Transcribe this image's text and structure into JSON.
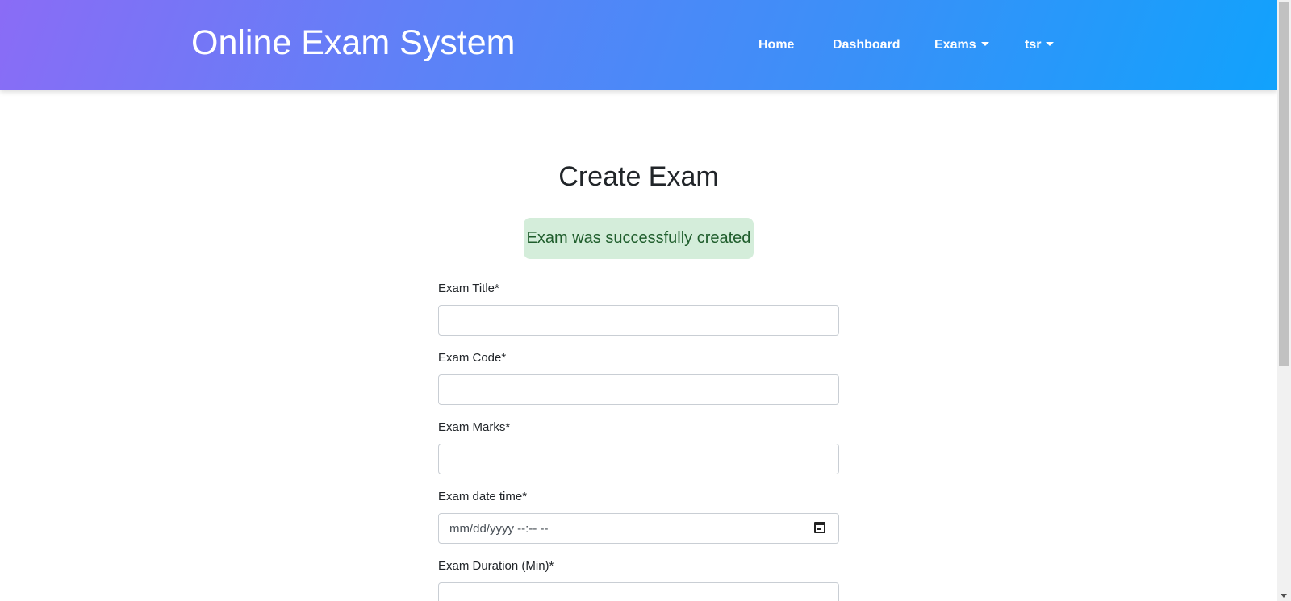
{
  "navbar": {
    "brand": "Online Exam System",
    "links": {
      "home": "Home",
      "dashboard": "Dashboard",
      "exams": "Exams",
      "user": "tsr"
    }
  },
  "main": {
    "title": "Create Exam",
    "alert": "Exam was successfully created"
  },
  "form": {
    "title_label": "Exam Title*",
    "title_value": "",
    "code_label": "Exam Code*",
    "code_value": "",
    "marks_label": "Exam Marks*",
    "marks_value": "",
    "datetime_label": "Exam date time*",
    "datetime_placeholder": "mm/dd/yyyy --:-- --",
    "duration_label": "Exam Duration (Min)*",
    "duration_value": ""
  },
  "icons": {
    "calendar": "calendar-icon",
    "caret": "chevron-down-icon"
  },
  "colors": {
    "header_gradient_start": "#8a6cf6",
    "header_gradient_end": "#11a2fc",
    "alert_bg": "#d4edda",
    "alert_text": "#1f5d2c"
  }
}
